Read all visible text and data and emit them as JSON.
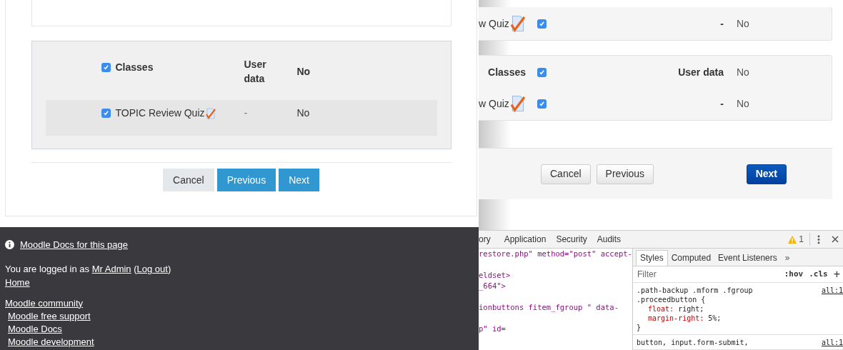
{
  "left_page": {
    "form": {
      "header": {
        "checked": true,
        "label": "Classes",
        "user_data": "User data",
        "value": "No"
      },
      "rows": [
        {
          "checked": true,
          "label": "TOPIC Review Quiz",
          "user_data": "-",
          "value": "No"
        }
      ]
    },
    "buttons": [
      {
        "label": "Cancel",
        "kind": "secondary"
      },
      {
        "label": "Previous",
        "kind": "primary"
      },
      {
        "label": "Next",
        "kind": "primary"
      }
    ],
    "footer": {
      "docs_link": "Moodle Docs for this page",
      "login_text": "You are logged in as ",
      "user_link": "Mr Admin",
      "open_paren": " (",
      "logout_link": "Log out",
      "close_paren": ")",
      "home_link": "Home",
      "links": [
        {
          "label": "Moodle community",
          "indented": false
        },
        {
          "label": "Moodle free support",
          "indented": true
        },
        {
          "label": "Moodle Docs",
          "indented": true
        },
        {
          "label": "Moodle development",
          "indented": true
        }
      ]
    }
  },
  "right_page": {
    "panels": [
      {
        "rows": [
          {
            "kind": "item",
            "label": "w Quiz",
            "checked": true,
            "user_data": "-",
            "value": "No"
          }
        ]
      },
      {
        "rows": [
          {
            "kind": "header",
            "label": "Classes",
            "checked": true,
            "user_data": "User data",
            "value": "No"
          },
          {
            "kind": "item",
            "label": "w Quiz",
            "checked": true,
            "user_data": "-",
            "value": "No"
          }
        ]
      }
    ],
    "buttons": [
      {
        "label": "Cancel",
        "kind": "secondary"
      },
      {
        "label": "Previous",
        "kind": "secondary"
      },
      {
        "label": "Next",
        "kind": "primary"
      }
    ]
  },
  "devtools": {
    "tabs": [
      {
        "label": "ory",
        "selected": false
      },
      {
        "label": "Application",
        "selected": false
      },
      {
        "label": "Security",
        "selected": false
      },
      {
        "label": "Audits",
        "selected": false
      }
    ],
    "warning_count": "1",
    "code_lines": [
      {
        "text": "restore.php\" method=\"post\" accept-",
        "gap_before": false
      },
      {
        "text": "eldset>",
        "gap_before": true
      },
      {
        "text": "_664\">",
        "gap_before": false
      },
      {
        "text": "ionbuttons fitem_fgroup \" data-",
        "gap_before": true
      },
      {
        "text": "p\" id=",
        "gap_before": true
      }
    ],
    "styles_tabs": [
      {
        "label": "Styles",
        "selected": true
      },
      {
        "label": "Computed",
        "selected": false
      },
      {
        "label": "Event Listeners",
        "selected": false
      }
    ],
    "more_tabs": "»",
    "filter": {
      "placeholder": "Filter"
    },
    "hov": ":hov",
    "cls": ".cls",
    "add": "+",
    "rules": [
      {
        "selector": [
          ".path-backup .mform .fgroup",
          ".proceedbutton {"
        ],
        "source": "all:1",
        "declarations": [
          {
            "property": "float:",
            "value": "right;"
          },
          {
            "property": "margin-right:",
            "value": "5%;"
          }
        ],
        "close": "}"
      },
      {
        "selector": [
          "button, input.form-submit,"
        ],
        "source": "all:1"
      }
    ]
  }
}
